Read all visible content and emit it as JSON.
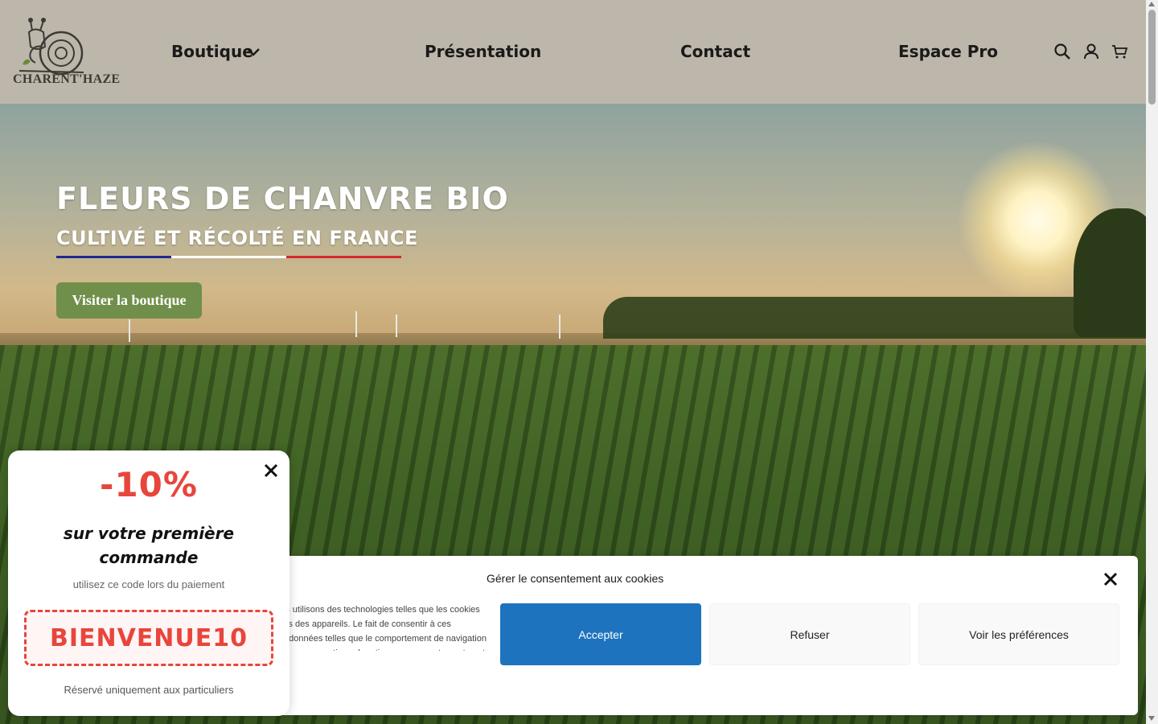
{
  "brand": {
    "name": "CHARENT'HAZE"
  },
  "nav": {
    "items": [
      {
        "label": "Boutique"
      },
      {
        "label": "Présentation"
      },
      {
        "label": "Contact"
      },
      {
        "label": "Espace Pro"
      }
    ]
  },
  "header_icons": [
    "search-icon",
    "account-icon",
    "cart-icon"
  ],
  "hero": {
    "title": "Fleurs de chanvre bio",
    "subtitle": "Cultivé et récolté en France",
    "button_label": "Visiter la boutique",
    "flag_colors": [
      "#1d2b8f",
      "#ffffff",
      "#d42a2a"
    ]
  },
  "cookie_banner": {
    "title": "Gérer le consentement aux cookies",
    "text": "Pour offrir les meilleures expériences, nous utilisons des technologies telles que les cookies pour stocker et/ou accéder aux informations des appareils. Le fait de consentir à ces technologies nous permettra de traiter des données telles que le comportement de navigation ou les ID uniques sur ce site. Le fait de ne pas consentir ou de retirer son consentement peut",
    "accept_label": "Accepter",
    "refuse_label": "Refuser",
    "prefs_label": "Voir les préférences"
  },
  "promo": {
    "discount": "-10%",
    "line": "sur votre première commande",
    "hint": "utilisez ce code lors du paiement",
    "code": "BIENVENUE10",
    "note": "Réservé uniquement aux particuliers"
  },
  "colors": {
    "header_bg": "#bdb6aa",
    "button_green": "#6f8f4a",
    "accept_blue": "#1e73be",
    "promo_red": "#e8453c"
  }
}
